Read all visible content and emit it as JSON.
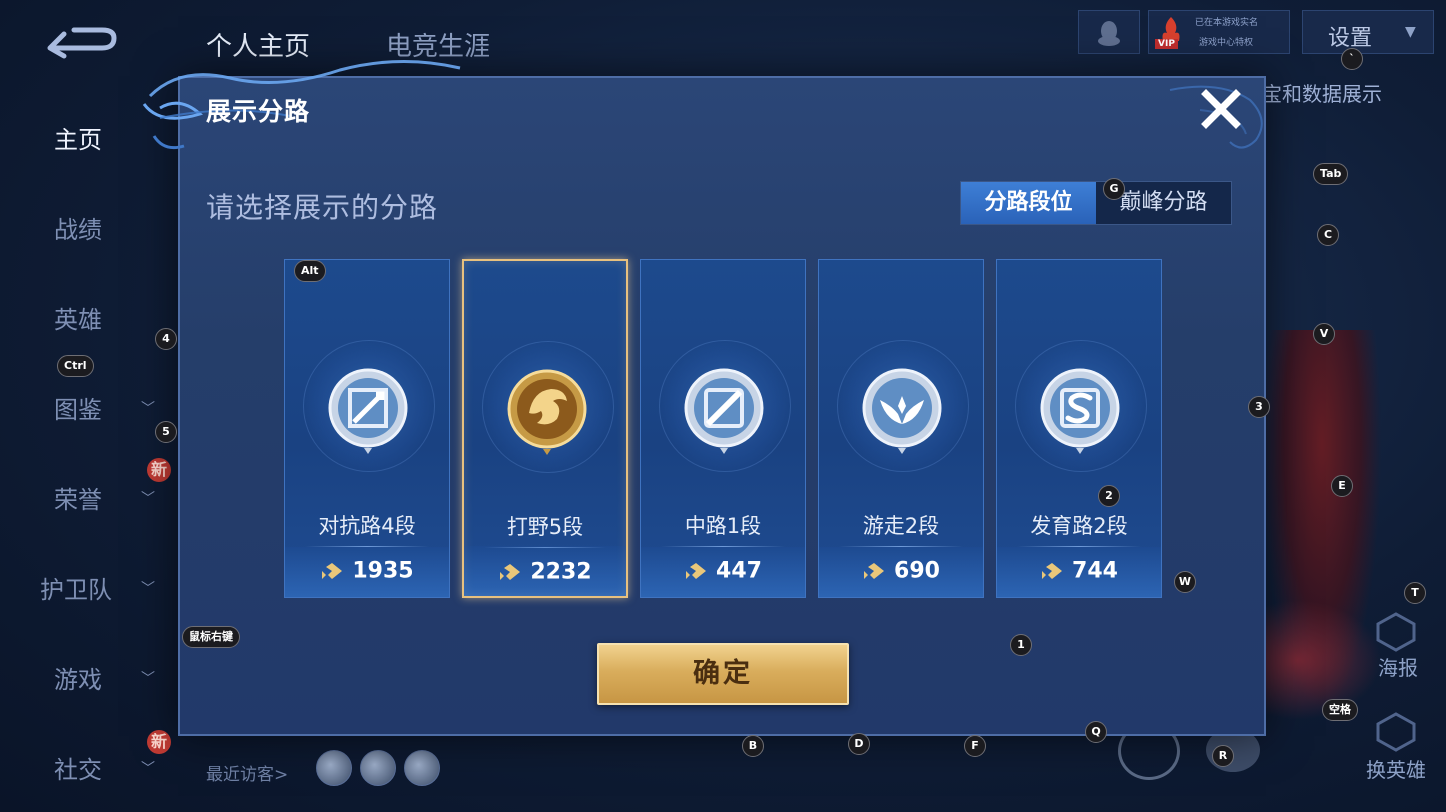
{
  "background": {
    "top_tabs": [
      "个人主页",
      "电竞生涯"
    ],
    "settings_label": "设置",
    "vip_label": "VIP",
    "vip_line1": "已在本游戏实名",
    "vip_line2": "游戏中心特权",
    "peek_text": "宝和数据展示",
    "sidebar": [
      {
        "label": "主页",
        "active": true,
        "chevron": false,
        "new": false
      },
      {
        "label": "战绩",
        "active": false,
        "chevron": false,
        "new": false
      },
      {
        "label": "英雄",
        "active": false,
        "chevron": false,
        "new": false
      },
      {
        "label": "图鉴",
        "active": false,
        "chevron": true,
        "new": false
      },
      {
        "label": "荣誉",
        "active": false,
        "chevron": true,
        "new": true
      },
      {
        "label": "护卫队",
        "active": false,
        "chevron": true,
        "new": false
      },
      {
        "label": "游戏",
        "active": false,
        "chevron": true,
        "new": false
      },
      {
        "label": "社交",
        "active": false,
        "chevron": true,
        "new": true
      }
    ],
    "new_badge": "新",
    "visitors_label": "最近访客>",
    "right_controls": [
      "海报",
      "换英雄"
    ]
  },
  "modal": {
    "title": "展示分路",
    "prompt": "请选择展示的分路",
    "toggle": {
      "left": "分路段位",
      "right": "巅峰分路",
      "active": "left"
    },
    "confirm_label": "确定",
    "cards": [
      {
        "rank": "对抗路4段",
        "score": "1935",
        "selected": false,
        "icon": "sword-badge-icon",
        "tone": "silver"
      },
      {
        "rank": "打野5段",
        "score": "2232",
        "selected": true,
        "icon": "dragon-badge-icon",
        "tone": "gold"
      },
      {
        "rank": "中路1段",
        "score": "447",
        "selected": false,
        "icon": "slash-badge-icon",
        "tone": "silver"
      },
      {
        "rank": "游走2段",
        "score": "690",
        "selected": false,
        "icon": "wings-badge-icon",
        "tone": "silver"
      },
      {
        "rank": "发育路2段",
        "score": "744",
        "selected": false,
        "icon": "s-badge-icon",
        "tone": "silver"
      }
    ]
  },
  "key_hints": {
    "alt": "Alt",
    "ctrl": "Ctrl",
    "tab": "Tab",
    "space": "空格",
    "right_click": "鼠标右键",
    "k4": "4",
    "k5": "5",
    "k3": "3",
    "k2": "2",
    "k1": "1",
    "kG": "G",
    "kC": "C",
    "kV": "V",
    "kE": "E",
    "kW": "W",
    "kT": "T",
    "kQ": "Q",
    "kR": "R",
    "kB": "B",
    "kD": "D",
    "kF": "F",
    "kBacktick": "`"
  },
  "colors": {
    "accent_blue": "#2a62b8",
    "gold": "#d9ad5c",
    "modal_bg": "#253e6a"
  }
}
